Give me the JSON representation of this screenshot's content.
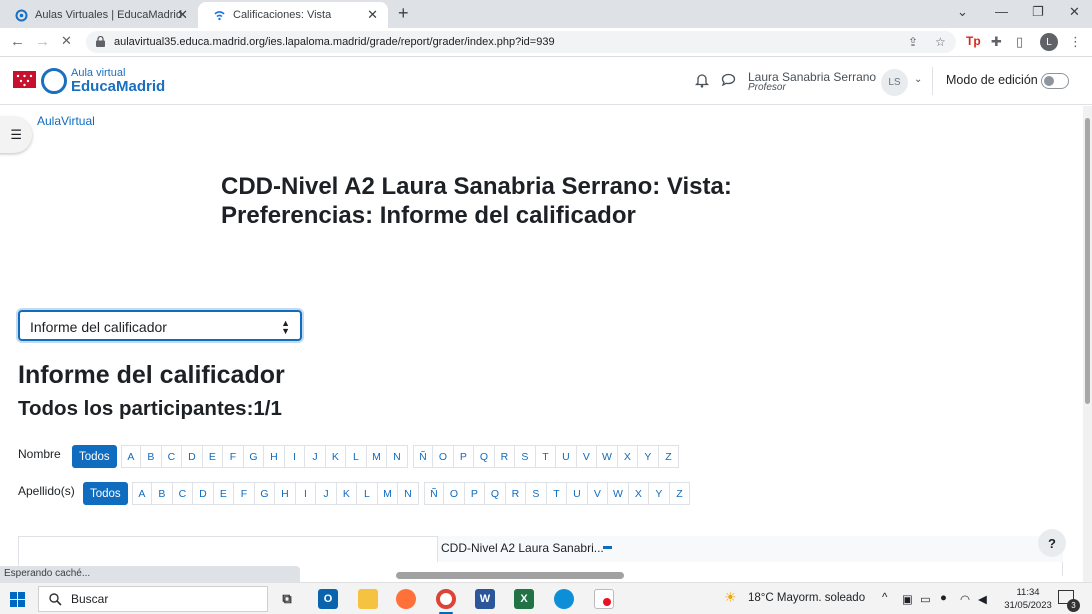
{
  "browser": {
    "tabs": [
      {
        "label": "Aulas Virtuales | EducaMadrid",
        "active": false
      },
      {
        "label": "Calificaciones: Vista",
        "active": true
      }
    ],
    "url": "aulavirtual35.educa.madrid.org/ies.lapaloma.madrid/grade/report/grader/index.php?id=939",
    "profile_initial": "L",
    "status_text": "Esperando caché..."
  },
  "navbar": {
    "logo_line1": "Aula virtual",
    "logo_line2": "EducaMadrid",
    "user_name": "Laura Sanabria Serrano",
    "user_role": "Profesor",
    "user_initials": "LS",
    "edit_mode_label": "Modo de edición",
    "edit_mode_on": false
  },
  "breadcrumb": "AulaVirtual",
  "page": {
    "title": "CDD-Nivel A2 Laura Sanabria Serrano: Vista: Preferencias: Informe del calificador",
    "report_select_value": "Informe del calificador",
    "heading": "Informe del calificador",
    "subheading": "Todos los participantes:1/1"
  },
  "filters": {
    "first_name_label": "Nombre",
    "last_name_label": "Apellido(s)",
    "all_label": "Todos",
    "letters_group1": [
      "A",
      "B",
      "C",
      "D",
      "E",
      "F",
      "G",
      "H",
      "I",
      "J",
      "K",
      "L",
      "M",
      "N"
    ],
    "letters_group2": [
      "Ñ",
      "O",
      "P",
      "Q",
      "R",
      "S",
      "T",
      "U",
      "V",
      "W",
      "X",
      "Y",
      "Z"
    ]
  },
  "table": {
    "column_header": "CDD-Nivel A2 Laura Sanabri..."
  },
  "help_label": "?",
  "taskbar": {
    "search_placeholder": "Buscar",
    "weather": "18°C  Mayorm. soleado",
    "time": "11:34",
    "date": "31/05/2023",
    "notifications": "3"
  },
  "colors": {
    "moodle_blue": "#0f6cbf",
    "chrome_tabbar": "#dee1e6",
    "madrid_red": "#c8102e"
  }
}
